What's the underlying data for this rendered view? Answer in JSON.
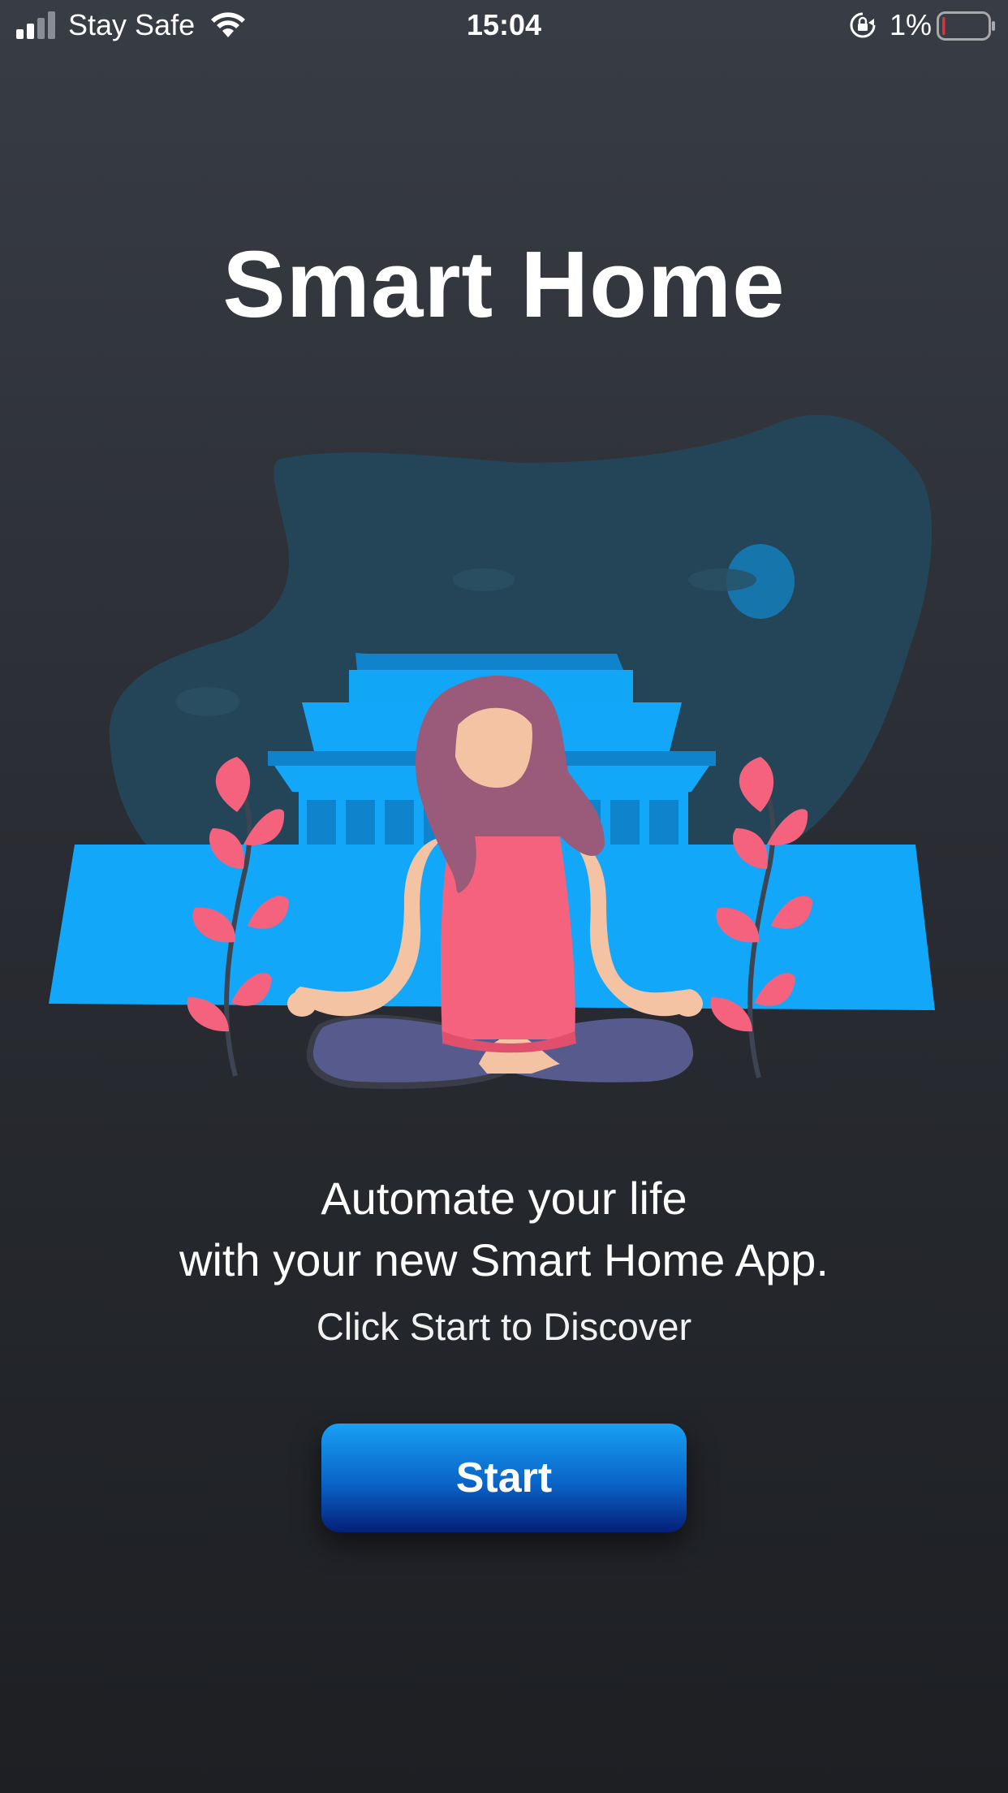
{
  "status_bar": {
    "carrier": "Stay Safe",
    "time": "15:04",
    "battery_percent": "1%",
    "signal_bars_active": 2,
    "signal_bars_total": 4,
    "battery_level": 0.01,
    "icons": [
      "signal-icon",
      "wifi-icon",
      "rotation-lock-icon",
      "battery-icon"
    ]
  },
  "main": {
    "title": "Smart Home",
    "tagline_line1": "Automate your life",
    "tagline_line2": "with your new Smart Home App.",
    "subtitle": "Click Start to Discover",
    "start_label": "Start"
  },
  "colors": {
    "background_top": "#383c44",
    "background_bottom": "#1d1f23",
    "accent": "#13a7fa",
    "button_top": "#18a0f4",
    "button_bottom": "#041f78",
    "leaf_pink": "#f5627e",
    "battery_low": "#e0303a"
  }
}
